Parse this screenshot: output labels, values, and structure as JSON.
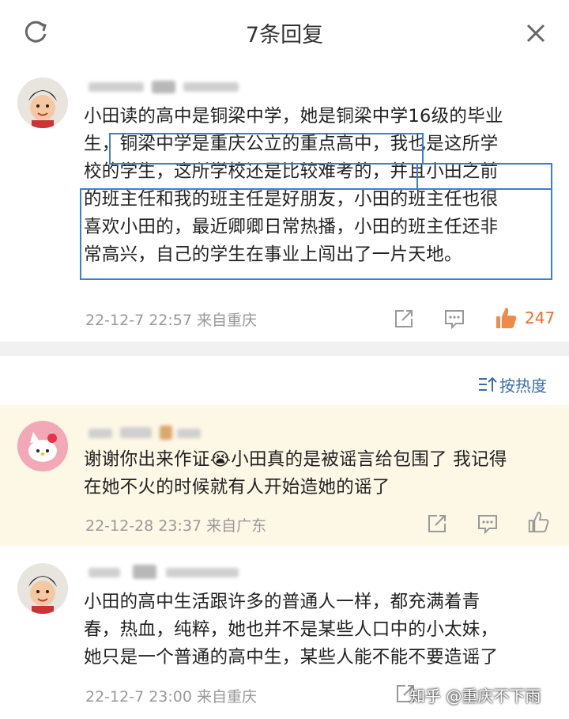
{
  "header": {
    "title": "7条回复"
  },
  "thread": {
    "text_lines": [
      "小田读的高中是铜梁中学，她是铜梁中学16级的毕业",
      "生，铜梁中学是重庆公立的重点高中，我也是这所学",
      "校的学生，这所学校还是比较难考的，并且小田之前",
      "的班主任和我的班主任是好朋友，小田的班主任也很",
      "喜欢小田的，最近卿卿日常热播，小田的班主任还非",
      "常高兴，自己的学生在事业上闯出了一片天地。"
    ],
    "meta": "22-12-7 22:57  来自重庆",
    "likes": "247"
  },
  "sort_label": "按热度",
  "replies": [
    {
      "text_lines": [
        "谢谢你出来作证😭小田真的是被谣言给包围了 我记得",
        "在她不火的时候就有人开始造她的谣了"
      ],
      "meta": "22-12-28 23:37  来自广东"
    },
    {
      "text_lines": [
        "小田的高中生活跟许多的普通人一样，都充满着青",
        "春，热血，纯粹，她也并不是某些人口中的小太妹，",
        "她只是一个普通的高中生，某些人能不能不要造谣了"
      ],
      "meta": "22-12-7 23:00  来自重庆"
    }
  ],
  "watermark": "知乎 @重庆不下雨",
  "colors": {
    "accent_blue": "#3d7fcc",
    "like_orange": "#e8702a",
    "highlight_bg": "#fdf7e6"
  }
}
